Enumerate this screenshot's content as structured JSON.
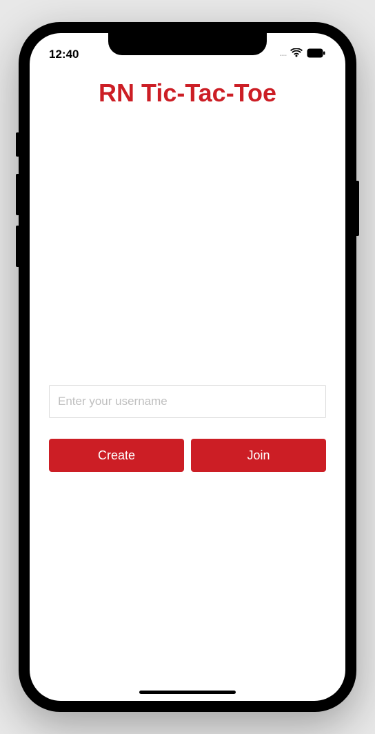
{
  "statusBar": {
    "time": "12:40",
    "signal_dots": "····"
  },
  "app": {
    "title": "RN Tic-Tac-Toe"
  },
  "form": {
    "usernamePlaceholder": "Enter your username",
    "usernameValue": "",
    "createLabel": "Create",
    "joinLabel": "Join"
  },
  "colors": {
    "brand": "#cc1e25"
  }
}
